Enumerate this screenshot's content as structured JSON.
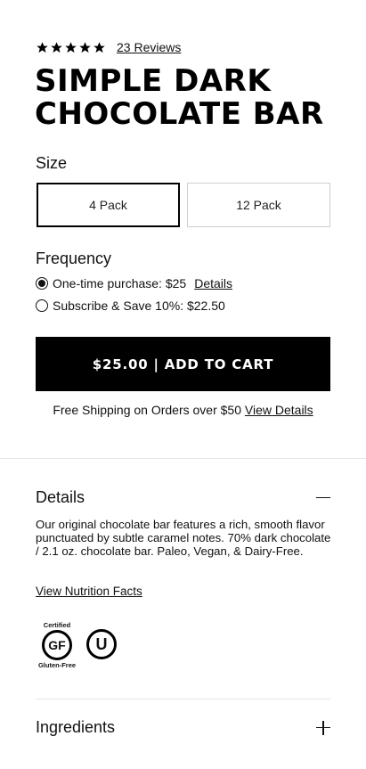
{
  "rating": {
    "stars": 5,
    "reviews_label": "23 Reviews"
  },
  "product": {
    "title_line1": "SIMPLE DARK",
    "title_line2": "CHOCOLATE BAR"
  },
  "size": {
    "label": "Size",
    "options": [
      "4 Pack",
      "12 Pack"
    ],
    "selected": "4 Pack"
  },
  "frequency": {
    "label": "Frequency",
    "one_time_label": "One-time purchase: $25",
    "details_link": "Details",
    "subscribe_label": "Subscribe & Save 10%: $22.50",
    "selected": "one-time"
  },
  "cart": {
    "button_label": "$25.00 | ADD TO CART"
  },
  "shipping": {
    "text": "Free Shipping on Orders over $50",
    "link": "View Details"
  },
  "details": {
    "heading": "Details",
    "description": "Our original chocolate bar features a rich, smooth flavor punctuated by subtle caramel notes.  70% dark chocolate / 2.1 oz. chocolate bar. Paleo, Vegan, & Dairy-Free.",
    "nutrition_link": "View Nutrition Facts",
    "icon": "minus-icon"
  },
  "badges": {
    "gluten_free_top": "Certified",
    "gluten_free_mark": "GF",
    "gluten_free_bottom": "Gluten-Free",
    "kosher_mark": "U"
  },
  "ingredients": {
    "heading": "Ingredients",
    "icon": "plus-icon"
  }
}
